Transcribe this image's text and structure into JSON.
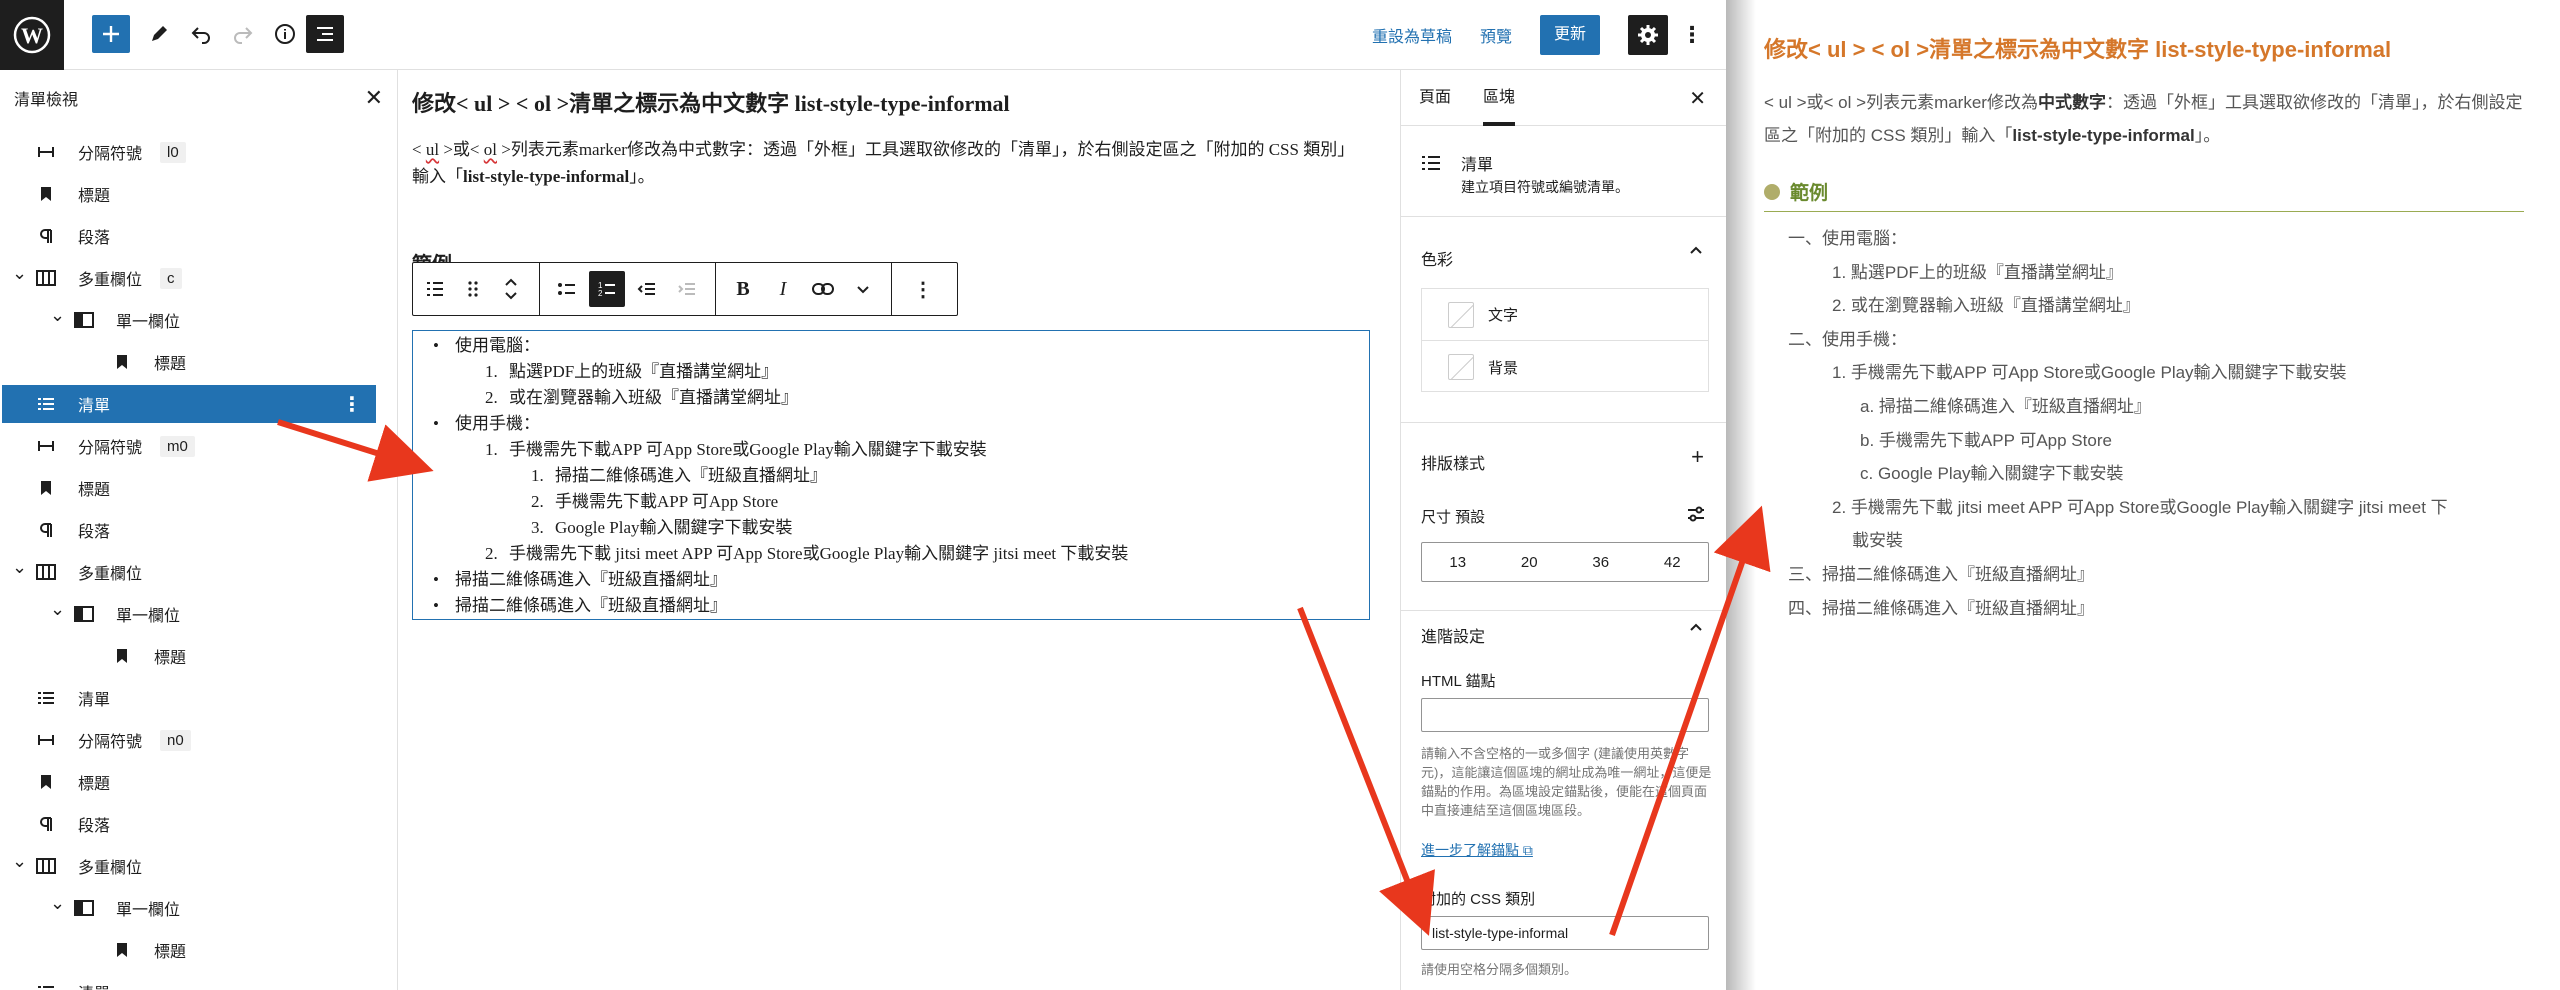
{
  "topbar": {
    "logo_icon": "wordpress-logo-icon",
    "tools": [
      "add-block-icon",
      "edit-pencil-icon",
      "undo-icon",
      "redo-icon",
      "info-icon",
      "list-view-icon"
    ],
    "save_draft": "重設為草稿",
    "preview": "預覽",
    "update": "更新"
  },
  "listview": {
    "title": "清單檢視",
    "rows": [
      {
        "label": "分隔符號",
        "anchor": "l0",
        "icon": "separator-icon",
        "indent": 1
      },
      {
        "label": "標題",
        "icon": "heading-bookmark-icon",
        "indent": 1
      },
      {
        "label": "段落",
        "icon": "paragraph-icon",
        "indent": 1
      },
      {
        "label": "多重欄位",
        "anchor": "c",
        "icon": "columns-icon",
        "indent": 1,
        "caret": true
      },
      {
        "label": "單一欄位",
        "icon": "column-icon",
        "indent": 2,
        "caret": true
      },
      {
        "label": "標題",
        "icon": "heading-bookmark-icon",
        "indent": 3
      },
      {
        "label": "清單",
        "icon": "list-icon",
        "indent": 1,
        "selected": true
      },
      {
        "label": "分隔符號",
        "anchor": "m0",
        "icon": "separator-icon",
        "indent": 1
      },
      {
        "label": "標題",
        "icon": "heading-bookmark-icon",
        "indent": 1
      },
      {
        "label": "段落",
        "icon": "paragraph-icon",
        "indent": 1
      },
      {
        "label": "多重欄位",
        "icon": "columns-icon",
        "indent": 1,
        "caret": true
      },
      {
        "label": "單一欄位",
        "icon": "column-icon",
        "indent": 2,
        "caret": true
      },
      {
        "label": "標題",
        "icon": "heading-bookmark-icon",
        "indent": 3
      },
      {
        "label": "清單",
        "icon": "list-icon",
        "indent": 1
      },
      {
        "label": "分隔符號",
        "anchor": "n0",
        "icon": "separator-icon",
        "indent": 1
      },
      {
        "label": "標題",
        "icon": "heading-bookmark-icon",
        "indent": 1
      },
      {
        "label": "段落",
        "icon": "paragraph-icon",
        "indent": 1
      },
      {
        "label": "多重欄位",
        "icon": "columns-icon",
        "indent": 1,
        "caret": true
      },
      {
        "label": "單一欄位",
        "icon": "column-icon",
        "indent": 2,
        "caret": true
      },
      {
        "label": "標題",
        "icon": "heading-bookmark-icon",
        "indent": 3
      },
      {
        "label": "清單",
        "icon": "list-icon",
        "indent": 1
      }
    ]
  },
  "editor": {
    "title": "修改< ul > < ol >清單之標示為中文數字 list-style-type-informal",
    "intro_a": "< ",
    "intro_ul": "ul",
    "intro_b": " >或< ",
    "intro_ol": "ol",
    "intro_c": " >列表元素marker修改為中式數字：透過「外框」工具選取欲修改的「清單」，於右側設定區之「附加的 CSS 類別」輸入「",
    "intro_bold": "list-style-type-informal",
    "intro_d": "」。",
    "example_heading": "範例",
    "list": [
      {
        "marker": "•",
        "text": "使用電腦：",
        "level": 0
      },
      {
        "marker": "1.",
        "text": "點選PDF上的班級『直播講堂網址』",
        "level": 1
      },
      {
        "marker": "2.",
        "text": "或在瀏覽器輸入班級『直播講堂網址』",
        "level": 1
      },
      {
        "marker": "•",
        "text": "使用手機：",
        "level": 0
      },
      {
        "marker": "1.",
        "text": "手機需先下載APP 可App Store或Google Play輸入關鍵字下載安裝",
        "level": 1
      },
      {
        "marker": "1.",
        "text": "掃描二維條碼進入『班級直播網址』",
        "level": 2
      },
      {
        "marker": "2.",
        "text": "手機需先下載APP 可App Store",
        "level": 2
      },
      {
        "marker": "3.",
        "text": "Google Play輸入關鍵字下載安裝",
        "level": 2
      },
      {
        "marker": "2.",
        "text": "手機需先下載 jitsi meet APP 可App Store或Google Play輸入關鍵字 jitsi meet 下載安裝",
        "level": 1
      },
      {
        "marker": "•",
        "text": "掃描二維條碼進入『班級直播網址』",
        "level": 0
      },
      {
        "marker": "•",
        "text": "掃描二維條碼進入『班級直播網址』",
        "level": 0
      }
    ]
  },
  "settings": {
    "tab_page": "頁面",
    "tab_block": "區塊",
    "block_name": "清單",
    "block_desc": "建立項目符號或編號清單。",
    "color_title": "色彩",
    "color_text": "文字",
    "color_bg": "背景",
    "typo_title": "排版樣式",
    "size_label": "尺寸 預設",
    "sizes": [
      "13",
      "20",
      "36",
      "42"
    ],
    "advanced_title": "進階設定",
    "anchor_label": "HTML 錨點",
    "anchor_help": "請輸入不含空格的一或多個字 (建議使用英數字元)，這能讓這個區塊的網址成為唯一網址，這便是錨點的作用。為區塊設定錨點後，便能在這個頁面中直接連結至這個區塊區段。",
    "anchor_link": "進一步了解錨點",
    "css_label": "附加的 CSS 類別",
    "css_value": "list-style-type-informal",
    "css_help": "請使用空格分隔多個類別。"
  },
  "doc": {
    "title": "修改< ul > < ol >清單之標示為中文數字 list-style-type-informal",
    "intro_a": "< ul >或< ol >列表元素marker修改為",
    "intro_b1": "中式數字",
    "intro_c": "：透過「外框」工具選取欲修改的「清單」，於右側設定區之「附加的 CSS 類別」輸入「",
    "intro_b2": "list-style-type-informal",
    "intro_d": "」。",
    "example": "範例",
    "lines": [
      {
        "text": "一、使用電腦：",
        "level": 0
      },
      {
        "text": "1. 點選PDF上的班級『直播講堂網址』",
        "level": 1
      },
      {
        "text": "2. 或在瀏覽器輸入班級『直播講堂網址』",
        "level": 1
      },
      {
        "text": "二、使用手機：",
        "level": 0
      },
      {
        "text": "1. 手機需先下載APP 可App Store或Google Play輸入關鍵字下載安裝",
        "level": 1
      },
      {
        "text": "a. 掃描二維條碼進入『班級直播網址』",
        "level": 2
      },
      {
        "text": "b. 手機需先下載APP 可App Store",
        "level": 2
      },
      {
        "text": "c. Google Play輸入關鍵字下載安裝",
        "level": 2
      },
      {
        "text": "2. 手機需先下載 jitsi meet APP 可App Store或Google Play輸入關鍵字 jitsi meet 下",
        "level": 1
      },
      {
        "text": "載安裝",
        "level": 1,
        "cont": true
      },
      {
        "text": "三、掃描二維條碼進入『班級直播網址』",
        "level": 0
      },
      {
        "text": "四、掃描二維條碼進入『班級直播網址』",
        "level": 0
      }
    ]
  },
  "colors": {
    "accent": "#2271b1",
    "dark": "#1e1e1e",
    "arrow": "#e8371d",
    "doc_title": "#d5772a",
    "doc_example": "#6a8a2e"
  }
}
